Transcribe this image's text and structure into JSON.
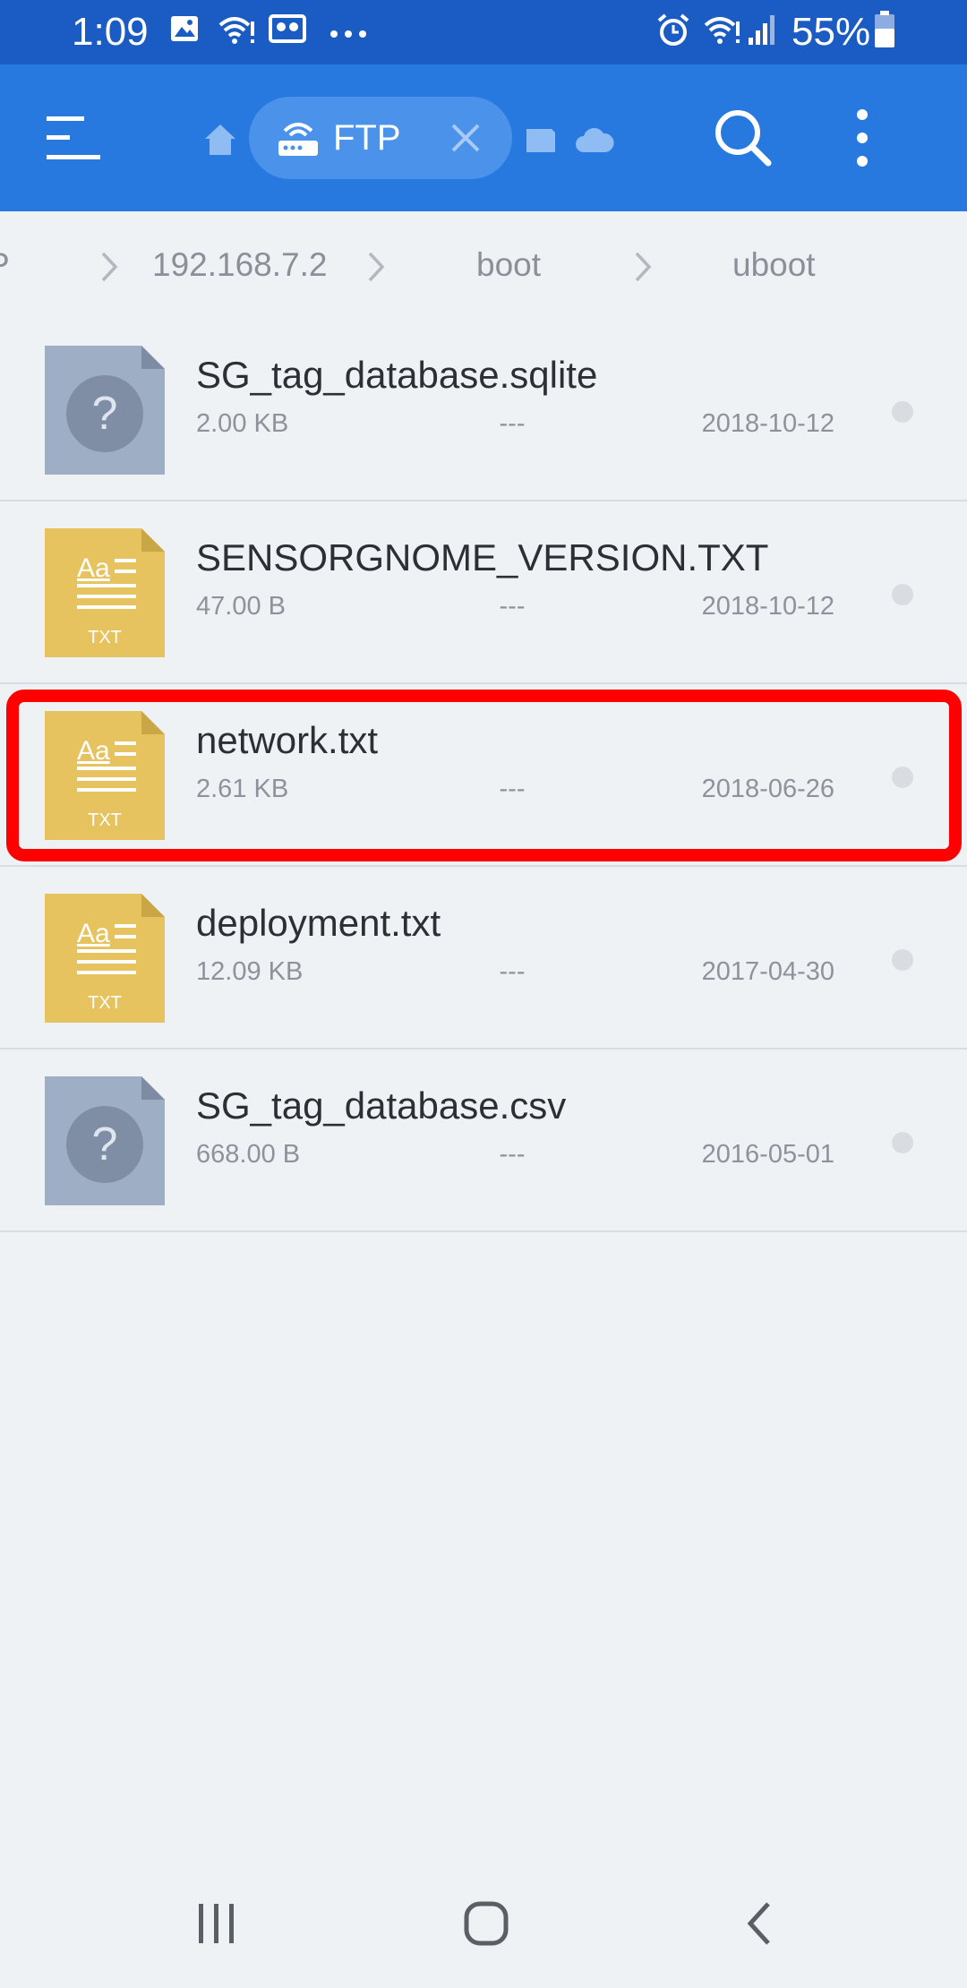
{
  "status_bar": {
    "time": "1:09",
    "battery_percent": "55%",
    "left_icons": [
      "image-icon",
      "wifi-alert-icon",
      "voicemail-icon",
      "more-dots-icon"
    ],
    "right_icons": [
      "alarm-icon",
      "wifi-icon",
      "signal-icon",
      "battery-icon"
    ]
  },
  "app_bar": {
    "tabs": [
      {
        "icon": "home-icon"
      },
      {
        "icon": "ftp-icon",
        "label": "FTP",
        "active": true
      },
      {
        "icon": "sd-card-icon"
      },
      {
        "icon": "cloud-icon"
      }
    ],
    "actions": [
      "search-icon",
      "more-vert-icon"
    ]
  },
  "breadcrumb": {
    "items": [
      "192.168.7.2",
      "boot",
      "uboot"
    ]
  },
  "files": [
    {
      "name": "SG_tag_database.sqlite",
      "size": "2.00 KB",
      "perm": "---",
      "date": "2018-10-12",
      "type": "unknown"
    },
    {
      "name": "SENSORGNOME_VERSION.TXT",
      "size": "47.00 B",
      "perm": "---",
      "date": "2018-10-12",
      "type": "txt"
    },
    {
      "name": "network.txt",
      "size": "2.61 KB",
      "perm": "---",
      "date": "2018-06-26",
      "type": "txt"
    },
    {
      "name": "deployment.txt",
      "size": "12.09 KB",
      "perm": "---",
      "date": "2017-04-30",
      "type": "txt"
    },
    {
      "name": "SG_tag_database.csv",
      "size": "668.00 B",
      "perm": "---",
      "date": "2016-05-01",
      "type": "unknown"
    }
  ],
  "file_icons": {
    "txt": {
      "top_text": "Aa",
      "bottom_text": "TXT",
      "color": "#e6c35e"
    },
    "unknown": {
      "glyph": "?",
      "color": "#9eaec5"
    }
  },
  "highlighted_file_index": 2,
  "highlight_color": "#ff0000",
  "nav_bar": [
    "recents-icon",
    "home-circle-icon",
    "back-icon"
  ]
}
